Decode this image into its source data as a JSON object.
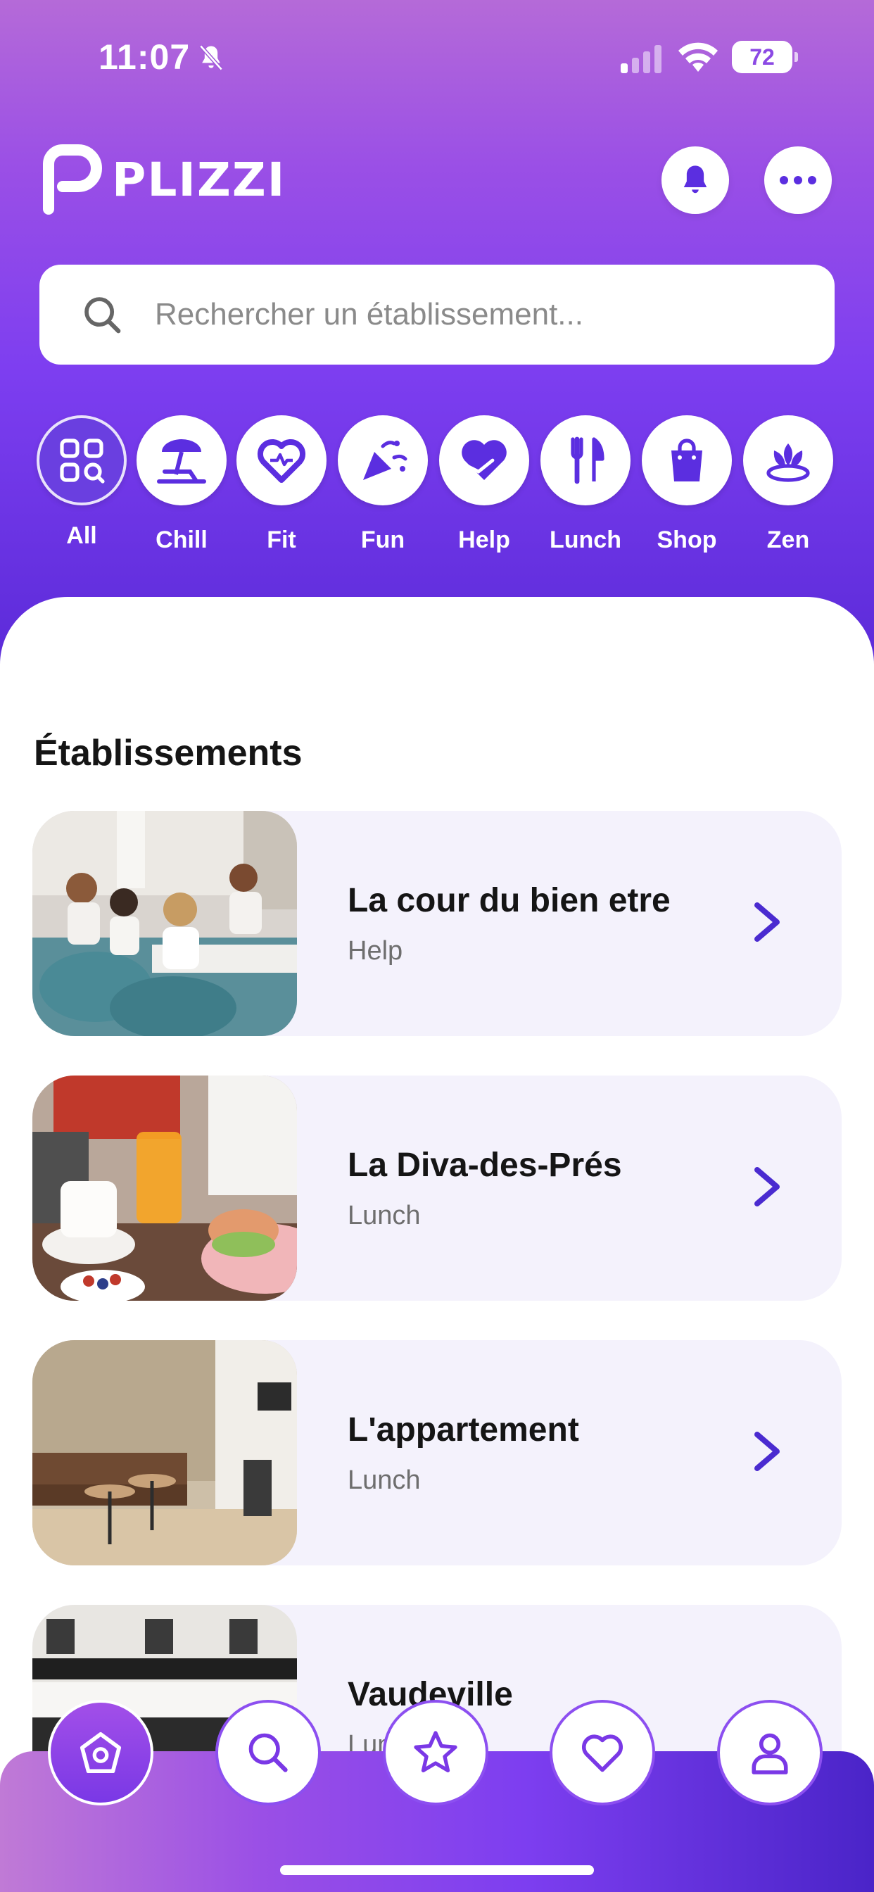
{
  "status_bar": {
    "time": "11:07",
    "battery": "72"
  },
  "brand": {
    "name": "PLIZZI"
  },
  "search": {
    "placeholder": "Rechercher un établissement..."
  },
  "categories": [
    {
      "label": "All",
      "icon": "grid-search-icon",
      "active": true
    },
    {
      "label": "Chill",
      "icon": "beach-icon"
    },
    {
      "label": "Fit",
      "icon": "heart-outline-icon"
    },
    {
      "label": "Fun",
      "icon": "party-popper-icon"
    },
    {
      "label": "Help",
      "icon": "heart-hands-icon"
    },
    {
      "label": "Lunch",
      "icon": "fork-knife-icon"
    },
    {
      "label": "Shop",
      "icon": "shopping-bag-icon"
    },
    {
      "label": "Zen",
      "icon": "lotus-icon"
    }
  ],
  "section": {
    "title": "Établissements"
  },
  "establishments": [
    {
      "name": "La cour du bien etre",
      "category": "Help"
    },
    {
      "name": "La Diva-des-Prés",
      "category": "Lunch"
    },
    {
      "name": "L'appartement",
      "category": "Lunch"
    },
    {
      "name": "Vaudeville",
      "category": "Lunch"
    }
  ],
  "bottom_nav": [
    {
      "id": "home",
      "icon": "home-icon",
      "active": true
    },
    {
      "id": "search",
      "icon": "search-icon"
    },
    {
      "id": "favorites-star",
      "icon": "star-icon"
    },
    {
      "id": "likes",
      "icon": "heart-icon"
    },
    {
      "id": "profile",
      "icon": "user-icon"
    }
  ],
  "colors": {
    "accent": "#5b2ee0",
    "gradient_top": "#b56ad8",
    "gradient_bottom": "#5a2ad8",
    "card_bg": "#f4f2fc"
  }
}
